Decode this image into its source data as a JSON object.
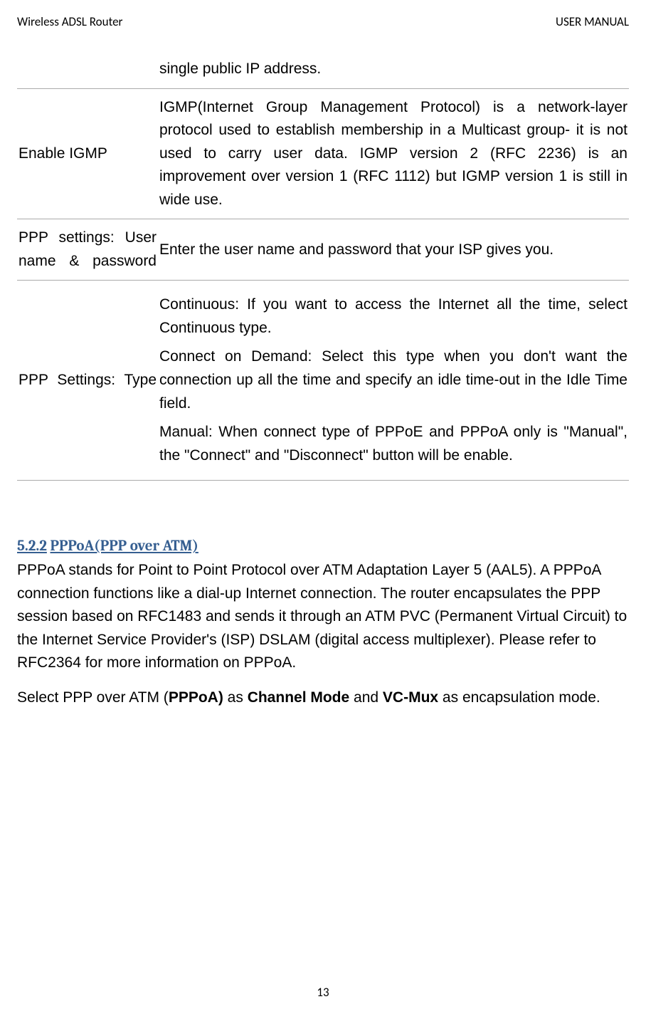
{
  "header": {
    "left": "Wireless ADSL Router",
    "right": "USER MANUAL"
  },
  "table": {
    "row0": {
      "label": "",
      "desc": "single public IP address."
    },
    "row1": {
      "label": "Enable IGMP",
      "desc": "IGMP(Internet Group Management Protocol) is a network-layer protocol used to establish membership in a Multicast group- it is not used to carry user data. IGMP version 2 (RFC 2236) is an improvement over version 1 (RFC 1112) but IGMP version 1 is still in wide use."
    },
    "row2": {
      "label": "PPP settings: User name & password",
      "desc": "Enter the user name and password that your ISP gives you."
    },
    "row3": {
      "label": "PPP Settings: Type",
      "p1": "Continuous: If you want to access the Internet all the time, select Continuous type.",
      "p2": "Connect on Demand: Select this type when you don't want the connection up all the time and specify an idle time-out in the Idle Time field.",
      "p3": "Manual: When connect type of PPPoE and PPPoA only is \"Manual\", the \"Connect\" and \"Disconnect\" button will be enable."
    }
  },
  "section": {
    "number": "5.2.2",
    "title": "PPPoA(PPP over ATM)",
    "para1": "PPPoA stands for Point to Point Protocol over ATM Adaptation Layer 5 (AAL5). A PPPoA connection functions like a dial-up Internet connection. The router encapsulates the PPP session based on RFC1483 and sends it through an ATM PVC (Permanent Virtual Circuit) to the Internet Service Provider's (ISP) DSLAM (digital access multiplexer). Please refer to RFC2364 for more information on PPPoA.",
    "para2_pre": "Select PPP over ATM (",
    "para2_b1": "PPPoA)",
    "para2_mid1": " as ",
    "para2_b2": "Channel Mode",
    "para2_mid2": " and ",
    "para2_b3": "VC-Mux",
    "para2_post": " as encapsulation mode."
  },
  "footer": {
    "page": "13"
  }
}
